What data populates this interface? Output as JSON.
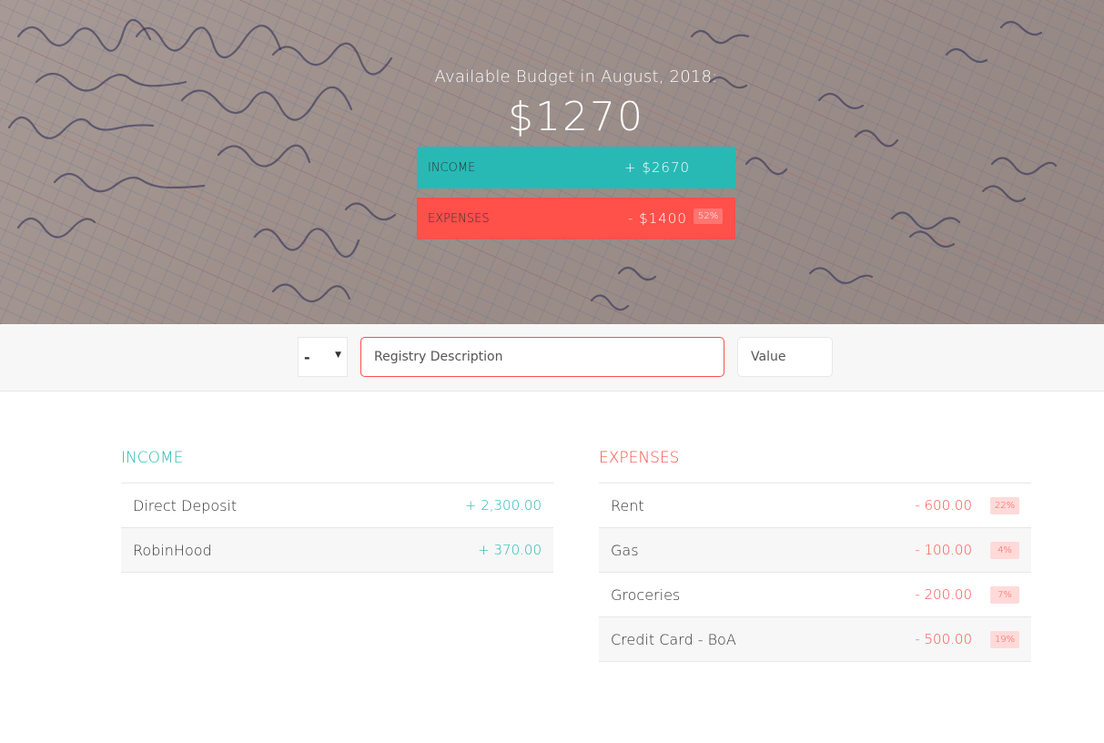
{
  "budget": {
    "title": "Available Budget in August, 2018:",
    "value": "$1270",
    "income_label": "Income",
    "income_value": "+ $2670",
    "expenses_label": "Expenses",
    "expenses_value": "- $1400",
    "expenses_percentage": "52%"
  },
  "add_bar": {
    "type_value": "-",
    "description_placeholder": "Registry Description",
    "value_placeholder": "Value"
  },
  "income": {
    "title": "Income",
    "items": [
      {
        "description": "Direct Deposit",
        "value": "+ 2,300.00"
      },
      {
        "description": "RobinHood",
        "value": "+ 370.00"
      }
    ]
  },
  "expenses": {
    "title": "Expenses",
    "items": [
      {
        "description": "Rent",
        "value": "- 600.00",
        "percentage": "22%"
      },
      {
        "description": "Gas",
        "value": "- 100.00",
        "percentage": "4%"
      },
      {
        "description": "Groceries",
        "value": "- 200.00",
        "percentage": "7%"
      },
      {
        "description": "Credit Card - BoA",
        "value": "- 500.00",
        "percentage": "19%"
      }
    ]
  },
  "colors": {
    "income": "#28B9B5",
    "expenses": "#FF5049"
  }
}
